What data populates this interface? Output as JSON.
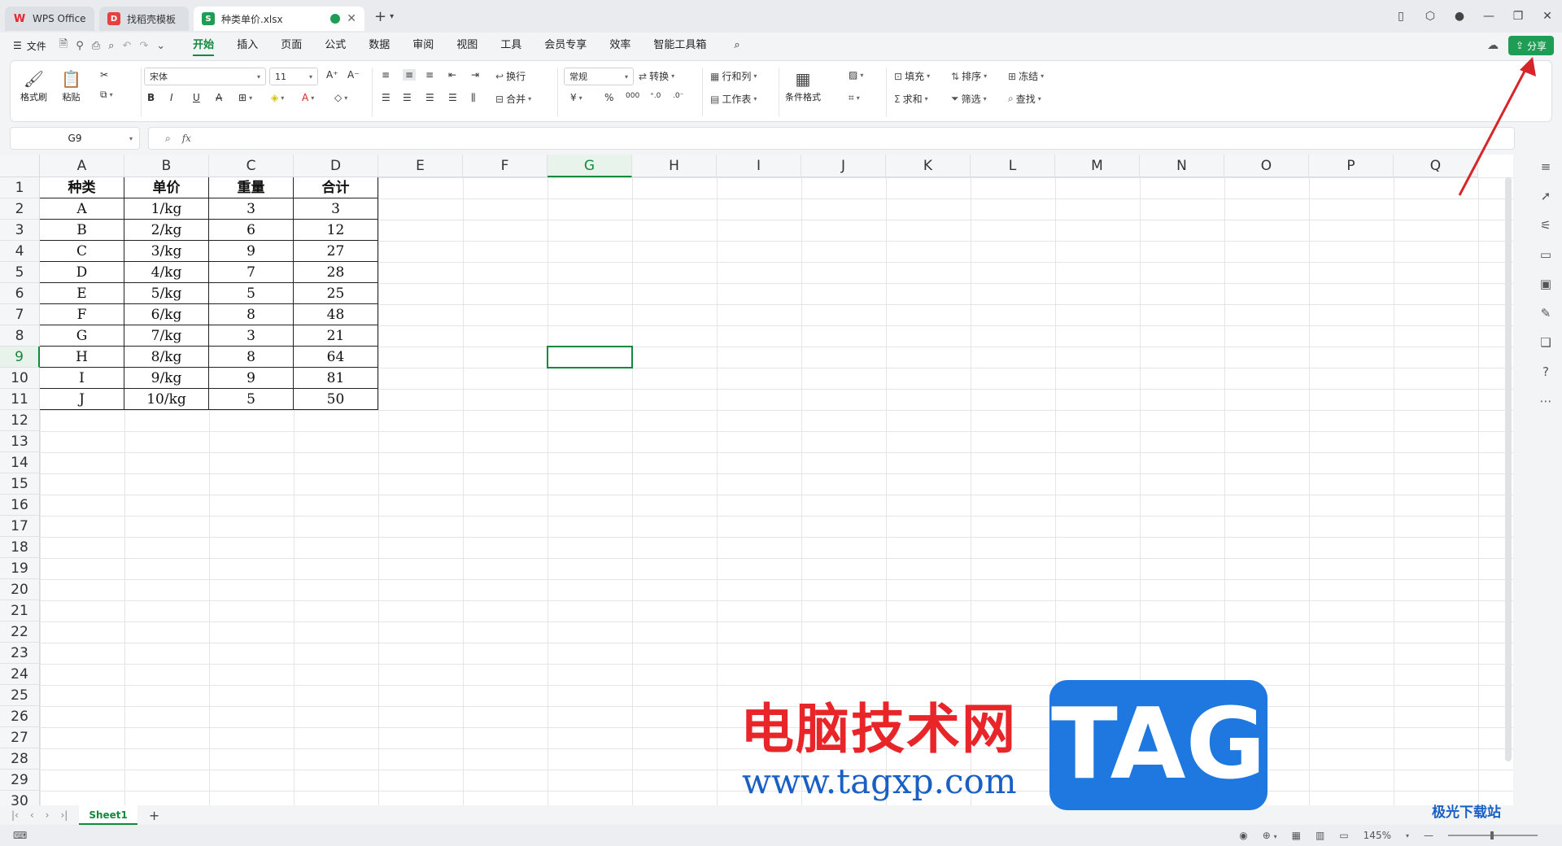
{
  "titlebar": {
    "tabs": [
      {
        "label": "WPS Office",
        "icon": "wps-logo-icon",
        "color": "#e8262a"
      },
      {
        "label": "找稻壳模板",
        "icon": "docer-icon",
        "color": "#e84040"
      },
      {
        "label": "种类单价.xlsx",
        "icon": "spreadsheet-icon",
        "color": "#1f9d55",
        "active": true
      }
    ],
    "new_tab": "+",
    "close_glyph": "✕"
  },
  "menubar": {
    "file": "文件",
    "tabs": [
      "开始",
      "插入",
      "页面",
      "公式",
      "数据",
      "审阅",
      "视图",
      "工具",
      "会员专享",
      "效率",
      "智能工具箱"
    ],
    "active_tab": "开始",
    "share": "分享"
  },
  "ribbon": {
    "format_painter": "格式刷",
    "paste": "粘贴",
    "font_name": "宋体",
    "font_size": "11",
    "wrap": "换行",
    "merge": "合并",
    "number_format": "常规",
    "convert": "转换",
    "rows_cols": "行和列",
    "worksheet": "工作表",
    "cond_format": "条件格式",
    "fill": "填充",
    "sort": "排序",
    "freeze": "冻结",
    "sum": "求和",
    "filter": "筛选",
    "find": "查找"
  },
  "formula_bar": {
    "name_box": "G9",
    "fx": "fx",
    "content": ""
  },
  "grid": {
    "columns": [
      "A",
      "B",
      "C",
      "D",
      "E",
      "F",
      "G",
      "H",
      "I",
      "J",
      "K",
      "L",
      "M",
      "N",
      "O",
      "P",
      "Q"
    ],
    "rows": [
      "1",
      "2",
      "3",
      "4",
      "5",
      "6",
      "7",
      "8",
      "9",
      "10",
      "11",
      "12",
      "13",
      "14",
      "15",
      "16",
      "17",
      "18",
      "19",
      "20",
      "21",
      "22",
      "23",
      "24",
      "25",
      "26",
      "27",
      "28",
      "29",
      "30"
    ],
    "selected_col": "G",
    "selected_row": "9",
    "table": {
      "headers": [
        "种类",
        "单价",
        "重量",
        "合计"
      ],
      "rows": [
        [
          "A",
          "1/kg",
          "3",
          "3"
        ],
        [
          "B",
          "2/kg",
          "6",
          "12"
        ],
        [
          "C",
          "3/kg",
          "9",
          "27"
        ],
        [
          "D",
          "4/kg",
          "7",
          "28"
        ],
        [
          "E",
          "5/kg",
          "5",
          "25"
        ],
        [
          "F",
          "6/kg",
          "8",
          "48"
        ],
        [
          "G",
          "7/kg",
          "3",
          "21"
        ],
        [
          "H",
          "8/kg",
          "8",
          "64"
        ],
        [
          "I",
          "9/kg",
          "9",
          "81"
        ],
        [
          "J",
          "10/kg",
          "5",
          "50"
        ]
      ]
    }
  },
  "sheets": {
    "tabs": [
      "Sheet1"
    ],
    "add": "+"
  },
  "statusbar": {
    "zoom": "145%"
  },
  "watermark": {
    "title": "电脑技术网",
    "url": "www.tagxp.com",
    "tag": "TAG",
    "corner": "极光下载站"
  },
  "colors": {
    "accent": "#128a3c",
    "share_bg": "#1f9d55",
    "arrow": "#d6262a"
  }
}
